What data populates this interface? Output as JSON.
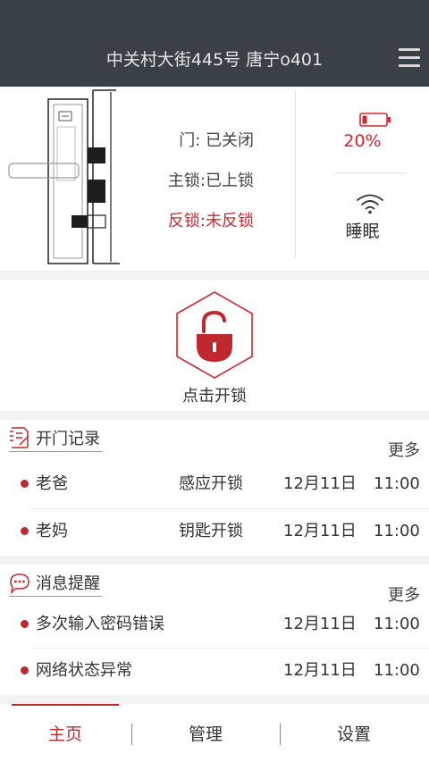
{
  "header": {
    "title": "中关村大街445号 唐宁o401",
    "menu_icon": "menu-icon"
  },
  "status": {
    "door": "门: 已关闭",
    "main_lock": "主锁:已上锁",
    "anti_lock": "反锁:未反锁",
    "battery": "20%",
    "battery_level": 0.2,
    "network": "睡眠"
  },
  "unlock": {
    "label": "点击开锁"
  },
  "records": {
    "title": "开门记录",
    "more": "更多",
    "items": [
      {
        "name": "老爸",
        "method": "感应开锁",
        "date": "12月11日",
        "time": "11:00"
      },
      {
        "name": "老妈",
        "method": "钥匙开锁",
        "date": "12月11日",
        "time": "11:00"
      }
    ]
  },
  "messages": {
    "title": "消息提醒",
    "more": "更多",
    "items": [
      {
        "text": "多次输入密码错误",
        "date": "12月11日",
        "time": "11:00"
      },
      {
        "text": "网络状态异常",
        "date": "12月11日",
        "time": "11:00"
      }
    ]
  },
  "tabs": [
    {
      "label": "主页",
      "active": true
    },
    {
      "label": "管理",
      "active": false
    },
    {
      "label": "设置",
      "active": false
    }
  ],
  "colors": {
    "accent": "#c0282f",
    "header_bg": "#394047",
    "alert": "#d32630"
  }
}
